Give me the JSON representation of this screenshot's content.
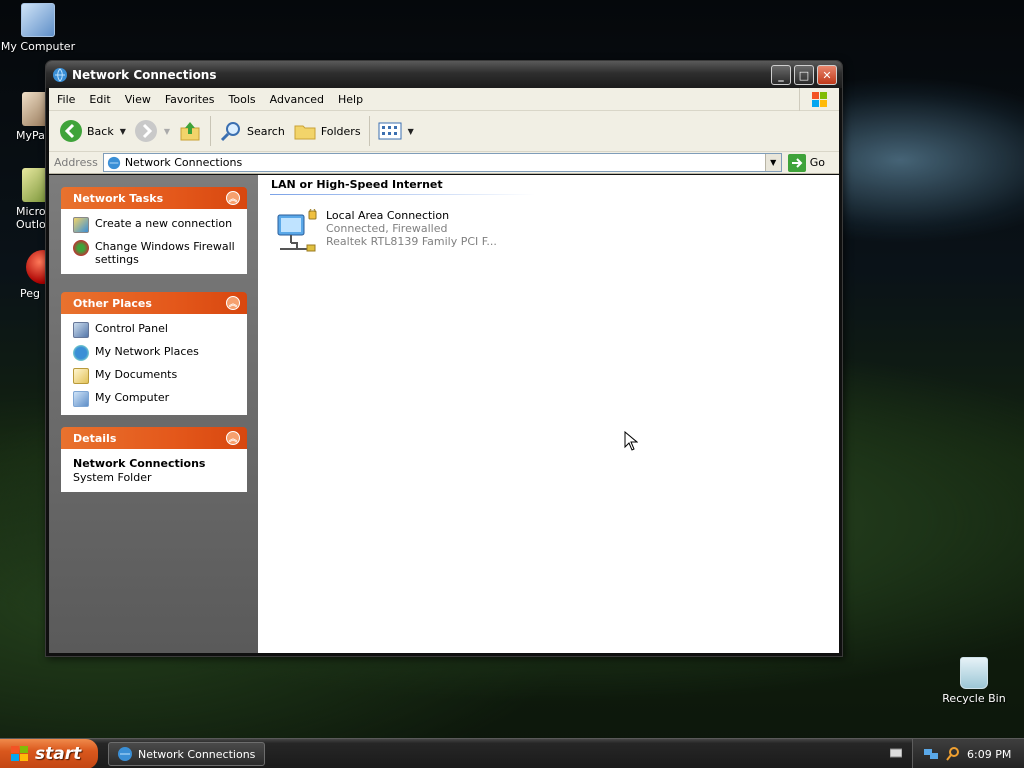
{
  "desktop": {
    "icons": [
      {
        "label": "My Computer",
        "icon": "my-computer-icon"
      },
      {
        "label": "MyPa",
        "icon": "mypapers-icon"
      },
      {
        "label": "Microsoft Outlook",
        "label_line1": "Micros",
        "label_line2": "Outlo",
        "icon": "outlook-icon"
      },
      {
        "label": "Peg",
        "icon": "pegasus-icon"
      },
      {
        "label": "Recycle Bin",
        "icon": "recycle-bin-icon"
      }
    ]
  },
  "window": {
    "title": "Network Connections",
    "menu": [
      "File",
      "Edit",
      "View",
      "Favorites",
      "Tools",
      "Advanced",
      "Help"
    ],
    "toolbar": {
      "back": "Back",
      "search": "Search",
      "folders": "Folders"
    },
    "address": {
      "label": "Address",
      "value": "Network Connections",
      "go": "Go"
    },
    "left_pane": {
      "network_tasks": {
        "title": "Network Tasks",
        "items": [
          "Create a new connection",
          "Change Windows Firewall settings"
        ]
      },
      "other_places": {
        "title": "Other Places",
        "items": [
          "Control Panel",
          "My Network Places",
          "My Documents",
          "My Computer"
        ]
      },
      "details": {
        "title": "Details",
        "name": "Network Connections",
        "type": "System Folder"
      }
    },
    "right_pane": {
      "group": "LAN or High-Speed Internet",
      "connection": {
        "name": "Local Area Connection",
        "status": "Connected, Firewalled",
        "device": "Realtek RTL8139 Family PCI F..."
      }
    }
  },
  "taskbar": {
    "start": "start",
    "task": "Network Connections",
    "clock": "6:09 PM"
  },
  "colors": {
    "task_panel_header": "#e4581b",
    "window_title": "#2e2e2e",
    "group_line": "#7ba2e7"
  }
}
